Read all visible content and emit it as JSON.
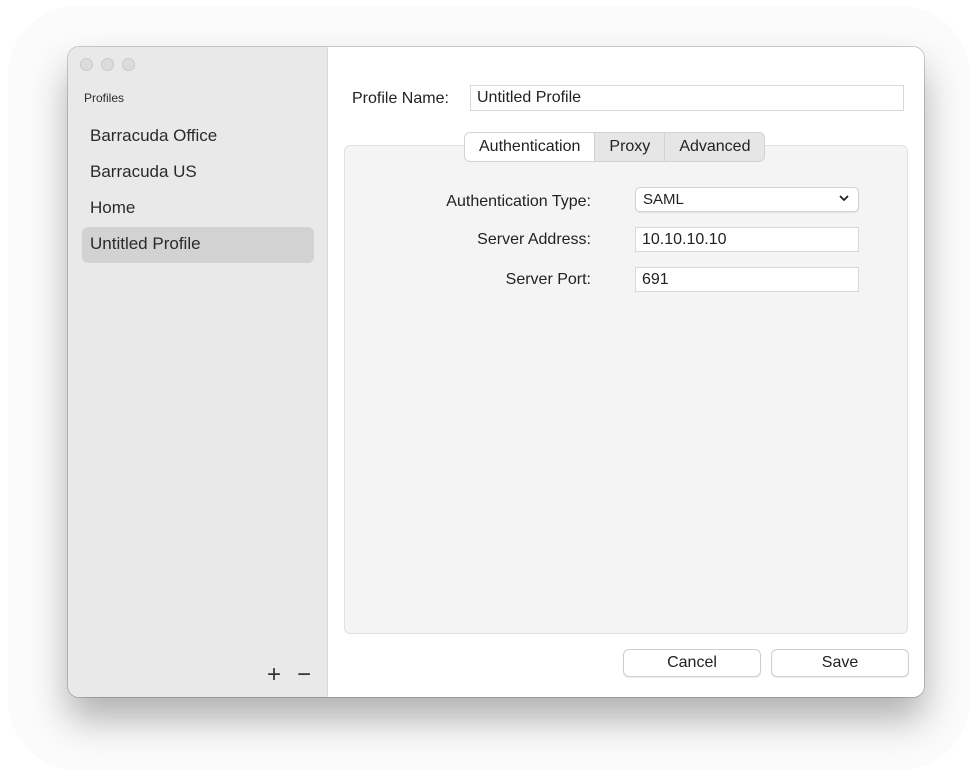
{
  "sidebar": {
    "header": "Profiles",
    "profiles": [
      {
        "label": "Barracuda Office"
      },
      {
        "label": "Barracuda US"
      },
      {
        "label": "Home"
      },
      {
        "label": "Untitled Profile"
      }
    ],
    "selected_index": 3,
    "add_label": "+",
    "remove_label": "−"
  },
  "main": {
    "profile_name_label": "Profile Name:",
    "profile_name_value": "Untitled Profile",
    "tabs": [
      {
        "label": "Authentication",
        "active": true
      },
      {
        "label": "Proxy",
        "active": false
      },
      {
        "label": "Advanced",
        "active": false
      }
    ],
    "auth": {
      "type_label": "Authentication Type:",
      "type_value": "SAML",
      "server_address_label": "Server Address:",
      "server_address_value": "10.10.10.10",
      "server_port_label": "Server Port:",
      "server_port_value": "691"
    },
    "cancel_label": "Cancel",
    "save_label": "Save"
  },
  "icons": {
    "dropdown": "chevron-down-icon"
  }
}
